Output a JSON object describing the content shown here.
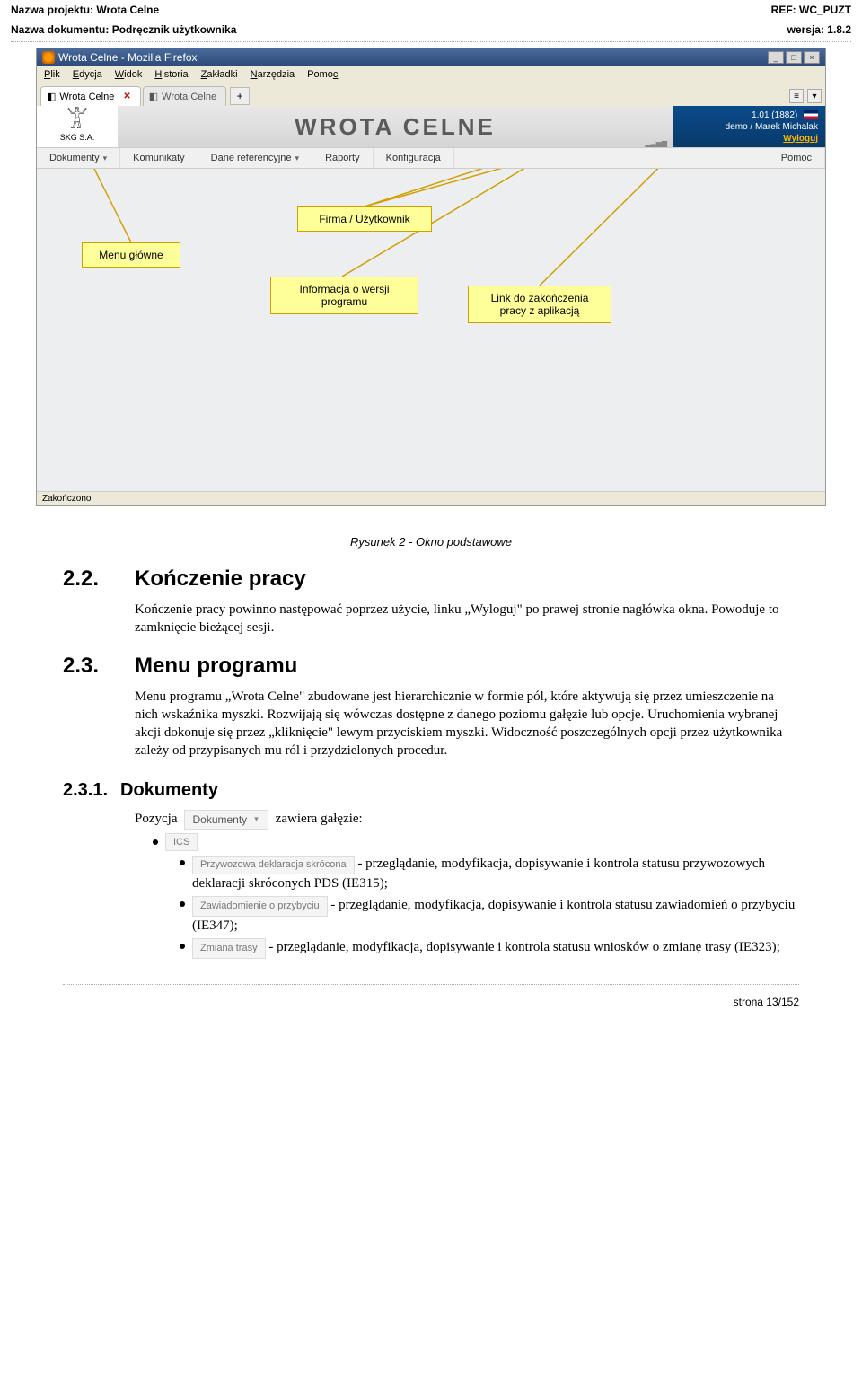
{
  "header": {
    "project_label": "Nazwa projektu:",
    "project_value": "Wrota Celne",
    "doc_label": "Nazwa dokumentu:",
    "doc_value": "Podręcznik użytkownika",
    "ref_label": "REF:",
    "ref_value": "WC_PUZT",
    "ver_label": "wersja:",
    "ver_value": "1.8.2"
  },
  "browser": {
    "title": "Wrota Celne - Mozilla Firefox",
    "menus": [
      "Plik",
      "Edycja",
      "Widok",
      "Historia",
      "Zakładki",
      "Narzędzia",
      "Pomoc"
    ],
    "tabs": [
      {
        "label": "Wrota Celne",
        "active": true
      },
      {
        "label": "Wrota Celne",
        "active": false
      }
    ],
    "status": "Zakończono"
  },
  "app": {
    "logo_text": "SKG S.A.",
    "brand": "WROTA CELNE",
    "version": "1.01 (1882)",
    "user_line": "demo / Marek Michalak",
    "logout": "Wyloguj",
    "menu": [
      "Dokumenty",
      "Komunikaty",
      "Dane referencyjne",
      "Raporty",
      "Konfiguracja",
      "Pomoc"
    ]
  },
  "callouts": {
    "main_menu": "Menu główne",
    "firm_user": "Firma / Użytkownik",
    "version_info": "Informacja o wersji programu",
    "logout_link": "Link do zakończenia pracy z aplikacją"
  },
  "caption": "Rysunek 2 - Okno podstawowe",
  "sections": {
    "s22_num": "2.2.",
    "s22_title": "Kończenie pracy",
    "s22_body": "Kończenie pracy powinno następować poprzez użycie, linku „Wyloguj\" po prawej stronie nagłówka okna. Powoduje to zamknięcie bieżącej sesji.",
    "s23_num": "2.3.",
    "s23_title": "Menu programu",
    "s23_body": "Menu programu „Wrota Celne\" zbudowane jest hierarchicznie w formie pól, które aktywują się przez umieszczenie na nich wskaźnika myszki. Rozwijają się wówczas dostępne z danego poziomu gałęzie lub opcje. Uruchomienia wybranej akcji dokonuje się przez „kliknięcie\" lewym przyciskiem myszki. Widoczność poszczególnych opcji przez użytkownika zależy od przypisanych mu ról i przydzielonych procedur.",
    "s231_num": "2.3.1.",
    "s231_title": "Dokumenty",
    "pozycja_label": "Pozycja",
    "dokumenty_chip": "Dokumenty",
    "zawiera": "zawiera gałęzie:",
    "ics_chip": "ICS",
    "pds_chip": "Przywozowa deklaracja skrócona",
    "pds_text": "- przeglądanie, modyfikacja, dopisywanie i kontrola statusu przywozowych deklaracji skróconych PDS (IE315);",
    "zop_chip": "Zawiadomienie o przybyciu",
    "zop_text": "- przeglądanie, modyfikacja, dopisywanie i kontrola statusu zawiadomień o przybyciu (IE347);",
    "zt_chip": "Zmiana trasy",
    "zt_text": "- przeglądanie, modyfikacja, dopisywanie i kontrola statusu wniosków o zmianę trasy (IE323);"
  },
  "footer": {
    "page": "strona 13/152"
  }
}
